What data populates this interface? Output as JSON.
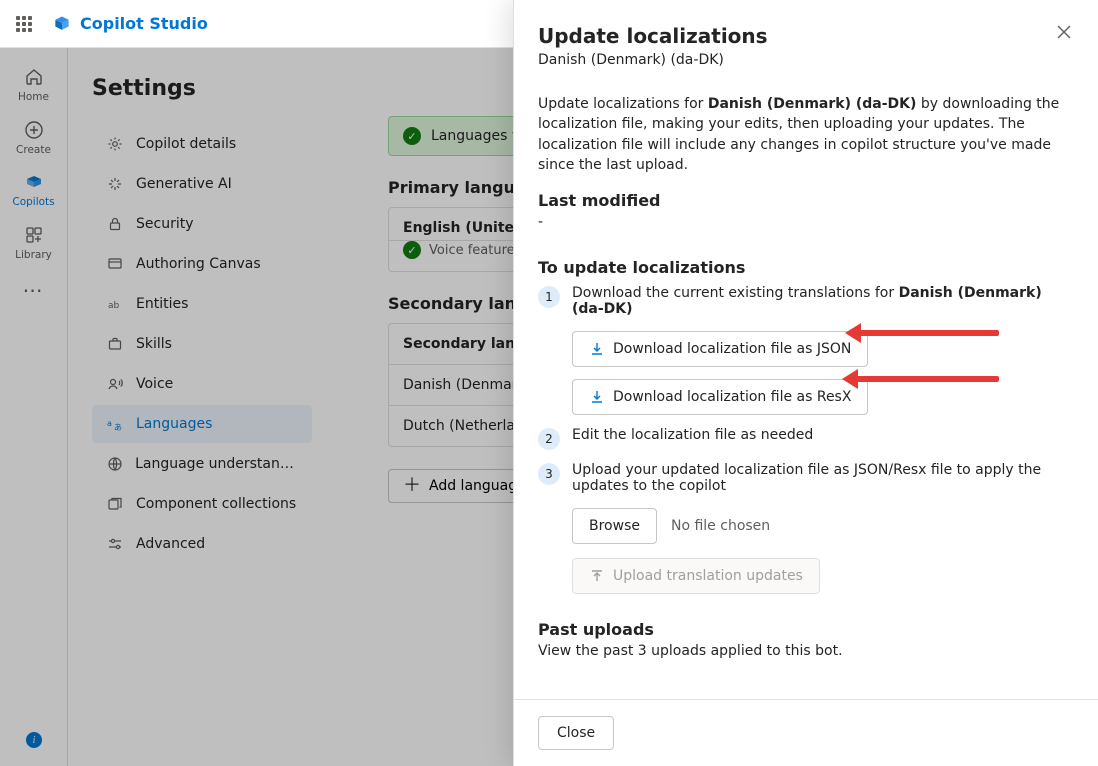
{
  "app": {
    "title": "Copilot Studio"
  },
  "rail": {
    "items": [
      {
        "label": "Home"
      },
      {
        "label": "Create"
      },
      {
        "label": "Copilots"
      },
      {
        "label": "Library"
      }
    ]
  },
  "page": {
    "title": "Settings"
  },
  "settings_nav": {
    "items": [
      {
        "key": "copilot-details",
        "label": "Copilot details"
      },
      {
        "key": "generative-ai",
        "label": "Generative AI"
      },
      {
        "key": "security",
        "label": "Security"
      },
      {
        "key": "authoring-canvas",
        "label": "Authoring Canvas"
      },
      {
        "key": "entities",
        "label": "Entities"
      },
      {
        "key": "skills",
        "label": "Skills"
      },
      {
        "key": "voice",
        "label": "Voice"
      },
      {
        "key": "languages",
        "label": "Languages"
      },
      {
        "key": "lu",
        "label": "Language understandi…"
      },
      {
        "key": "components",
        "label": "Component collections"
      },
      {
        "key": "advanced",
        "label": "Advanced"
      }
    ]
  },
  "alert": {
    "text": "Languages were added."
  },
  "primary": {
    "heading": "Primary language",
    "value": "English (United States) (en-US)",
    "voice_note": "Voice features supported"
  },
  "secondary": {
    "heading": "Secondary languages",
    "col_label": "Secondary language",
    "rows": [
      {
        "label": "Danish (Denmark) (da-DK)"
      },
      {
        "label": "Dutch (Netherlands) (nl-NL)"
      }
    ],
    "add_button": "Add language"
  },
  "panel": {
    "title": "Update localizations",
    "subtitle": "Danish (Denmark) (da-DK)",
    "intro_pre": "Update localizations for ",
    "intro_bold": "Danish (Denmark) (da-DK)",
    "intro_post": " by downloading the localization file, making your edits, then uploading your updates. The localization file will include any changes in copilot structure you've made since the last upload.",
    "last_modified_heading": "Last modified",
    "last_modified_value": "-",
    "steps_heading": "To update localizations",
    "step1_pre": "Download the current existing translations for ",
    "step1_bold": "Danish (Denmark) (da-DK)",
    "download_json": "Download localization file as JSON",
    "download_resx": "Download localization file as ResX",
    "step2": "Edit the localization file as needed",
    "step3": "Upload your updated localization file as JSON/Resx file to apply the updates to the copilot",
    "browse": "Browse",
    "no_file": "No file chosen",
    "upload_btn": "Upload translation updates",
    "past_heading": "Past uploads",
    "past_sub": "View the past 3 uploads applied to this bot.",
    "close": "Close"
  }
}
